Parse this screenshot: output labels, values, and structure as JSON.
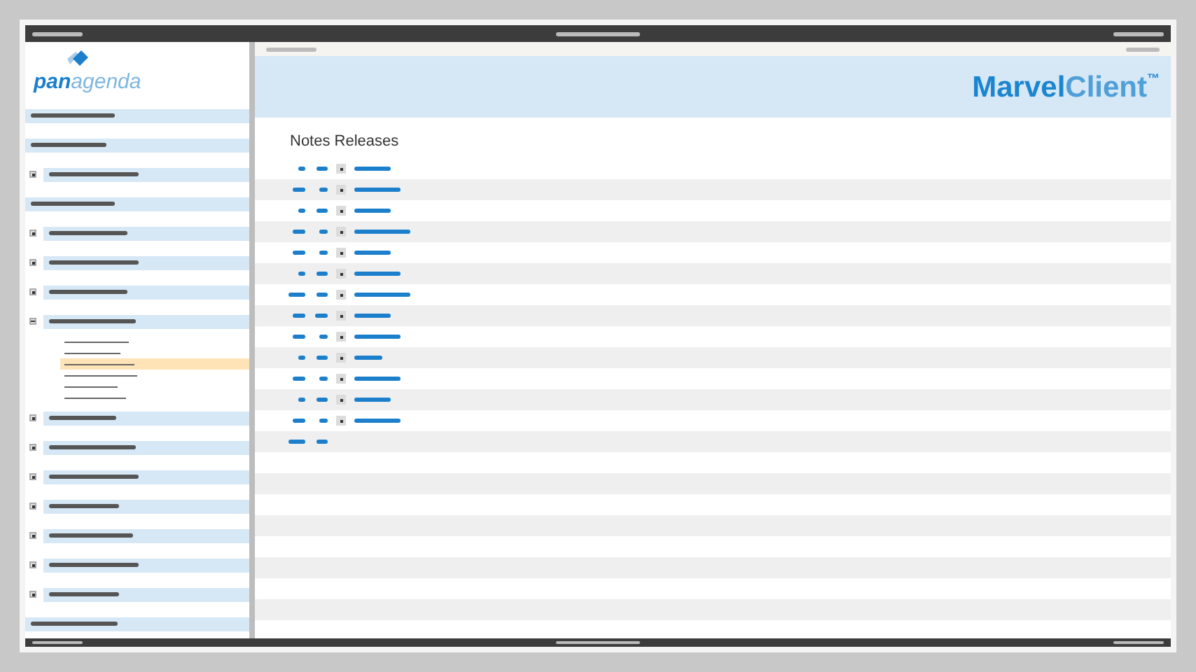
{
  "logo": {
    "strong": "pan",
    "light": "agenda"
  },
  "banner": {
    "strong": "Marvel",
    "light": "Client",
    "mark": "™"
  },
  "heading": "Notes Releases",
  "sidebar": {
    "items": [
      {
        "kind": "plain"
      },
      {
        "kind": "plain"
      },
      {
        "kind": "toggle",
        "expanded": false
      },
      {
        "kind": "plain"
      },
      {
        "kind": "toggle",
        "expanded": false
      },
      {
        "kind": "toggle",
        "expanded": false
      },
      {
        "kind": "toggle",
        "expanded": false
      },
      {
        "kind": "toggle",
        "expanded": true,
        "children": [
          {
            "selected": false
          },
          {
            "selected": false
          },
          {
            "selected": true
          },
          {
            "selected": false
          },
          {
            "selected": false
          },
          {
            "selected": false
          }
        ]
      },
      {
        "kind": "toggle",
        "expanded": false
      },
      {
        "kind": "toggle",
        "expanded": false
      },
      {
        "kind": "toggle",
        "expanded": false
      },
      {
        "kind": "toggle",
        "expanded": false
      },
      {
        "kind": "toggle",
        "expanded": false
      },
      {
        "kind": "toggle",
        "expanded": false
      },
      {
        "kind": "toggle",
        "expanded": false
      },
      {
        "kind": "plain"
      }
    ]
  },
  "releases": [
    {
      "expandable": true
    },
    {
      "expandable": true
    },
    {
      "expandable": true
    },
    {
      "expandable": true
    },
    {
      "expandable": true
    },
    {
      "expandable": true
    },
    {
      "expandable": true
    },
    {
      "expandable": true
    },
    {
      "expandable": true
    },
    {
      "expandable": true
    },
    {
      "expandable": true
    },
    {
      "expandable": true
    },
    {
      "expandable": true
    },
    {
      "expandable": false
    }
  ]
}
